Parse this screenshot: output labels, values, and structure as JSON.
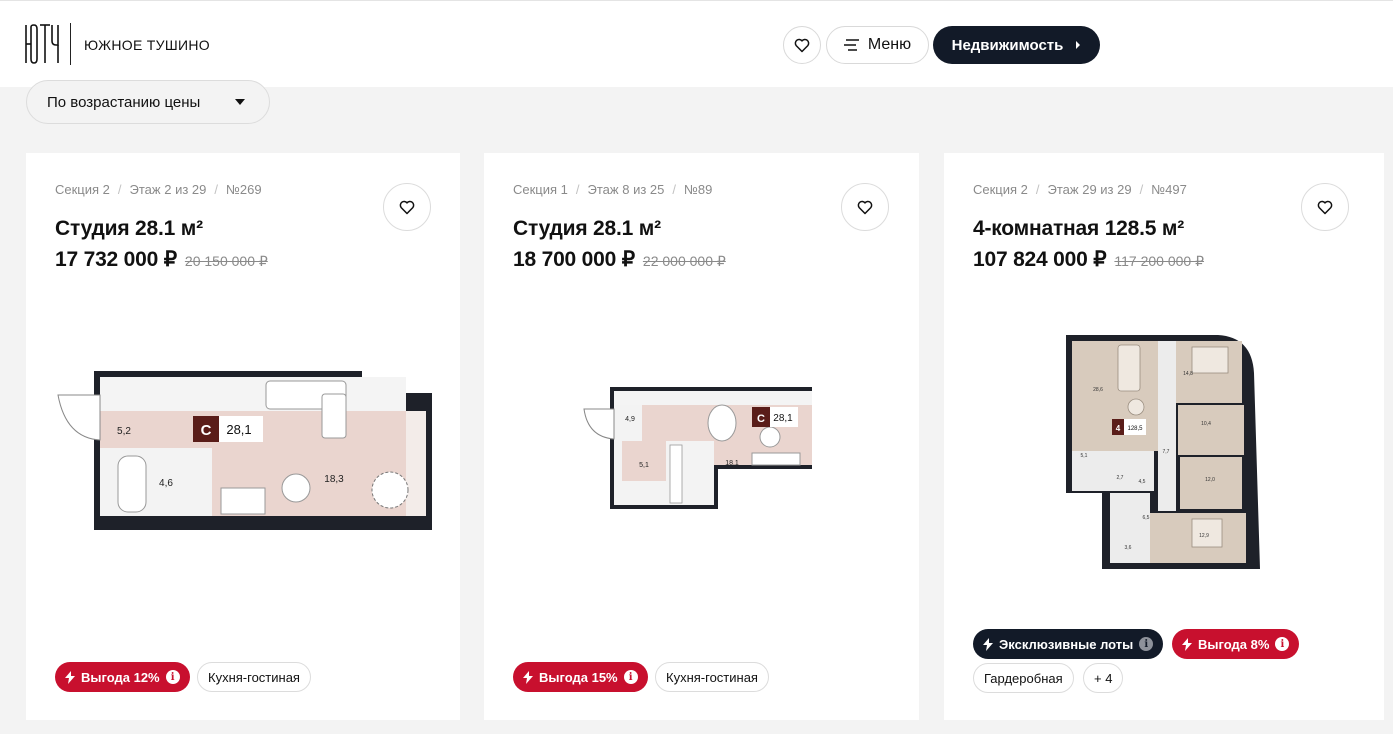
{
  "header": {
    "brand": "ЮЖНОЕ ТУШИНО",
    "menu_label": "Меню",
    "realty_label": "Недвижимость",
    "colors": {
      "accent": "#121a28",
      "promo": "#c8102e"
    }
  },
  "sort": {
    "label": "По возрастанию цены"
  },
  "cards": [
    {
      "section": "Секция 2",
      "floor": "Этаж 2 из 29",
      "number": "№269",
      "title": "Студия 28.1 м²",
      "price": "17 732 000 ₽",
      "old_price": "20 150 000 ₽",
      "plan": {
        "type_badge": "С",
        "area": "28,1",
        "rooms": [
          "5,2",
          "4,6",
          "18,3"
        ]
      },
      "tags": [
        {
          "label": "Выгода 12%",
          "style": "promo"
        },
        {
          "label": "Кухня-гостиная",
          "style": "outline"
        }
      ]
    },
    {
      "section": "Секция 1",
      "floor": "Этаж 8 из 25",
      "number": "№89",
      "title": "Студия 28.1 м²",
      "price": "18 700 000 ₽",
      "old_price": "22 000 000 ₽",
      "plan": {
        "type_badge": "С",
        "area": "28,1",
        "rooms": [
          "4,9",
          "5,1",
          "18,1"
        ]
      },
      "tags": [
        {
          "label": "Выгода 15%",
          "style": "promo"
        },
        {
          "label": "Кухня-гостиная",
          "style": "outline"
        }
      ]
    },
    {
      "section": "Секция 2",
      "floor": "Этаж 29 из 29",
      "number": "№497",
      "title": "4-комнатная 128.5 м²",
      "price": "107 824 000 ₽",
      "old_price": "117 200 000 ₽",
      "plan": {
        "type_badge": "4",
        "area": "128,5",
        "rooms": [
          "28,6",
          "14,8",
          "10,4",
          "5,1",
          "7,7",
          "12,0",
          "2,7",
          "4,5",
          "6,5",
          "12,9",
          "3,6"
        ]
      },
      "tags": [
        {
          "label": "Эксклюзивные лоты",
          "style": "dark"
        },
        {
          "label": "Выгода 8%",
          "style": "promo"
        },
        {
          "label": "Гардеробная",
          "style": "outline"
        },
        {
          "label": "+ 4",
          "style": "outline"
        }
      ]
    }
  ]
}
